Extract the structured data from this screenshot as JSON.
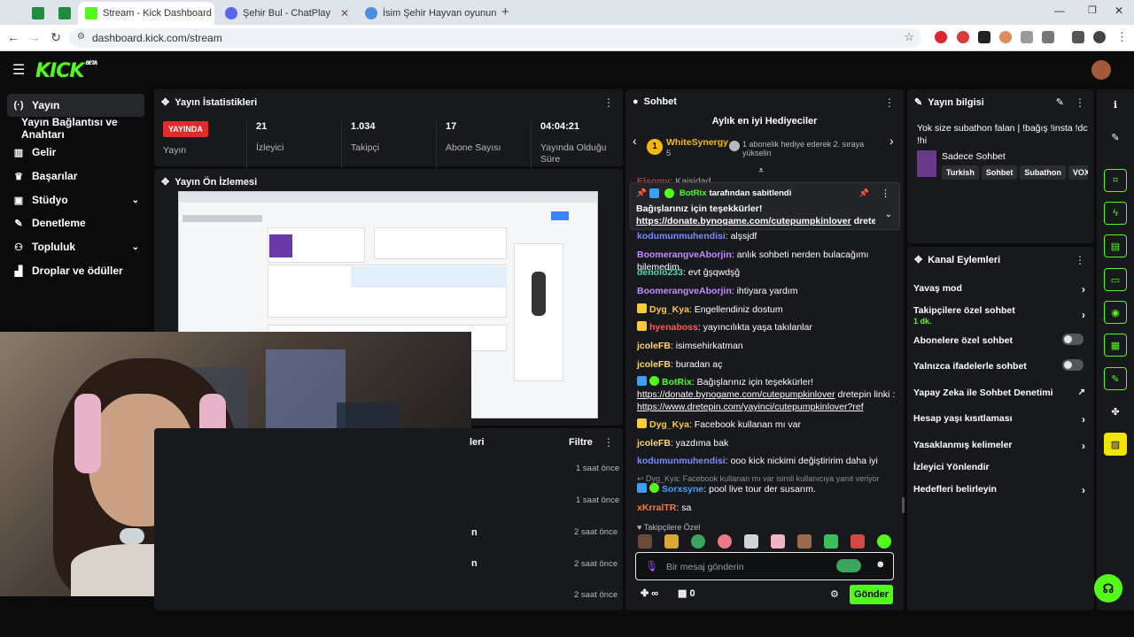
{
  "browser": {
    "tabs": [
      {
        "title": "",
        "fav_color": "#1e8e3e"
      },
      {
        "title": "",
        "fav_color": "#1e8e3e"
      },
      {
        "title": "Stream - Kick Dashboard",
        "fav_color": "#53fc18"
      },
      {
        "title": "Şehir Bul - ChatPlay",
        "fav_color": "#5865f2"
      },
      {
        "title": "İsim Şehir Hayvan oyununa kat",
        "fav_color": "#4a90e2"
      }
    ],
    "url": "dashboard.kick.com/stream"
  },
  "kick": {
    "logo": "KICK",
    "logo_sup": "BETA"
  },
  "sidebar": {
    "items": [
      {
        "label": "Yayın",
        "icon": "(·)"
      },
      {
        "label": "Yayın Bağlantısı ve Anahtarı",
        "icon": ""
      },
      {
        "label": "Gelir",
        "icon": "▥"
      },
      {
        "label": "Başarılar",
        "icon": "♛"
      },
      {
        "label": "Stüdyo",
        "icon": "▣"
      },
      {
        "label": "Denetleme",
        "icon": "✎"
      },
      {
        "label": "Topluluk",
        "icon": "⚇"
      },
      {
        "label": "Droplar ve ödüller",
        "icon": "▟"
      }
    ]
  },
  "stats": {
    "title": "Yayın İstatistikleri",
    "live_badge": "YAYINDA",
    "items": [
      {
        "value": "",
        "label": "Yayın"
      },
      {
        "value": "21",
        "label": "İzleyici"
      },
      {
        "value": "1.034",
        "label": "Takipçi"
      },
      {
        "value": "17",
        "label": "Abone Sayısı"
      },
      {
        "value": "04:04:21",
        "label": "Yayında Olduğu Süre"
      }
    ]
  },
  "preview": {
    "title": "Yayın Ön İzlemesi"
  },
  "activity": {
    "header_partial": "leri",
    "filter_label": "Filtre",
    "times": [
      "1 saat önce",
      "1 saat önce",
      "2 saat önce",
      "2 saat önce",
      "2 saat önce"
    ],
    "letters": [
      "n",
      "n"
    ]
  },
  "chat": {
    "title": "Sohbet",
    "gifters_title": "Aylık en iyi Hediyeciler",
    "top_gifter": "WhiteSynergy",
    "top_gifter_count": "5",
    "gift_note": "1 abonelik hediye ederek 2. sıraya yükselin",
    "pinned_by": "BotRix",
    "pinned_suffix": "tarafından sabitlendi",
    "pinned_text": "Bağışlarınız için teşekkürler!",
    "pinned_link": "https://donate.bynogame.com/cutepumpkinlover",
    "pinned_rest": "dretepin...",
    "cut_user": "Elsomy",
    "cut_text": ": Kaisidad",
    "messages": [
      {
        "user": "kodumunmuhendisi",
        "color": "#7b8cff",
        "text": ": alşsjdf"
      },
      {
        "user": "BoomerangveAborjin",
        "color": "#c58cff",
        "text": ": anlık sohbeti nerden bulacağımı bilemedim"
      },
      {
        "user": "denolo233",
        "color": "#4cd4b0",
        "text": ": evt ğşqwdşğ"
      },
      {
        "user": "BoomerangveAborjin",
        "color": "#c58cff",
        "text": ": ihtiyara yardım"
      },
      {
        "user": "Dyg_Kya",
        "color": "#ffcc33",
        "text": ": Engellendiniz dostum"
      },
      {
        "user": "hyenaboss",
        "color": "#ff5a5a",
        "text": ": yayıncılıkta yaşa takılanlar"
      },
      {
        "user": "jcoleFB",
        "color": "#ffd76b",
        "text": ": isimsehirkatman"
      },
      {
        "user": "jcoleFB",
        "color": "#ffd76b",
        "text": ": buradan aç"
      },
      {
        "user": "BotRix",
        "color": "#53fc18",
        "text": ": Bağışlarınız için teşekkürler!"
      },
      {
        "user": "Dyg_Kya",
        "color": "#ffcc33",
        "text": ": Facebook kullanan mı var"
      },
      {
        "user": "jcoleFB",
        "color": "#ffd76b",
        "text": ": yazdıma bak"
      },
      {
        "user": "kodumunmuhendisi",
        "color": "#7b8cff",
        "text": ": ooo kick nickimi değiştiririm daha iyi"
      },
      {
        "user": "Sorxsyne",
        "color": "#3aa0ff",
        "text": ": pool live tour der susarım."
      },
      {
        "user": "xKrralTR",
        "color": "#ff7a3a",
        "text": ": sa"
      }
    ],
    "botrix_link1": "https://donate.bynogame.com/cutepumpkinlover",
    "botrix_link1_suffix": " dretepin linki :",
    "botrix_link2": "https://www.dretepin.com/yayinci/cutepumpkinlover?ref",
    "reply_note": "Dyg_Kya: Facebook kullanan mı var isimli kullanıcıya yanıt veriyor",
    "followers_only": "Takipçilere Özel",
    "input_placeholder": "Bir mesaj gönderin",
    "points": "∞",
    "box_count": "0",
    "send_label": "Gönder"
  },
  "stream_info": {
    "title": "Yayın bilgisi",
    "stream_title": "Yok size subathon falan | !bağış !insta !dc !hi",
    "category": "Sadece Sohbet",
    "tags": [
      "Turkish",
      "Sohbet",
      "Subathon",
      "VOX"
    ]
  },
  "channel_actions": {
    "title": "Kanal Eylemleri",
    "rows": [
      {
        "label": "Yavaş mod",
        "type": "chevron"
      },
      {
        "label": "Takipçilere özel sohbet",
        "sub": "1 dk.",
        "type": "chevron"
      },
      {
        "label": "Abonelere özel sohbet",
        "type": "toggle"
      },
      {
        "label": "Yalnızca ifadelerle sohbet",
        "type": "toggle"
      },
      {
        "label": "Yapay Zeka ile Sohbet Denetimi",
        "type": "external"
      },
      {
        "label": "Hesap yaşı kısıtlaması",
        "type": "chevron"
      },
      {
        "label": "Yasaklanmış kelimeler",
        "type": "chevron"
      },
      {
        "label": "İzleyici Yönlendir",
        "type": "none"
      },
      {
        "label": "Hedefleri belirleyin",
        "type": "chevron"
      }
    ]
  },
  "colors": {
    "accent": "#53fc18",
    "live": "#e32b2b",
    "panel": "#18191c"
  }
}
